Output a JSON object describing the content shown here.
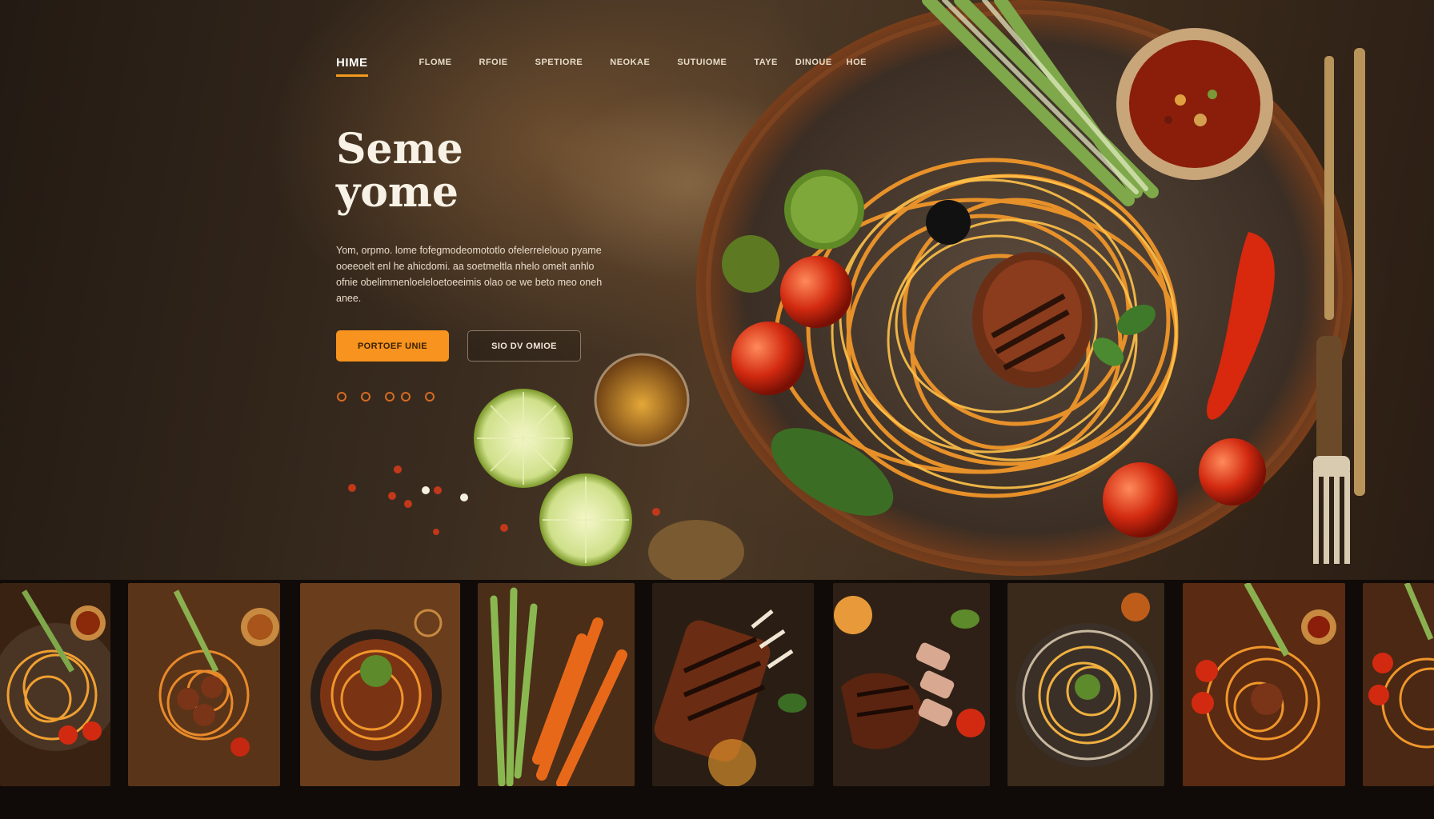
{
  "nav": {
    "items": [
      {
        "label": "HIME",
        "active": true
      },
      {
        "label": "FLOME"
      },
      {
        "label": "RFOIE"
      },
      {
        "label": "SPETIORE"
      },
      {
        "label": "NEOKAE"
      },
      {
        "label": "SUTUIOME"
      },
      {
        "label": "TAYE"
      },
      {
        "label": "DINOUE"
      },
      {
        "label": "HOE"
      }
    ]
  },
  "hero": {
    "title_line1": "Seme",
    "title_line2": "yome",
    "description": "Yom, orpmo. lome fofegmodeomototlo ofelerrelelouo pyame ooeeoelt enl he ahicdomi. aa soetmeltla nhelo omelt anhlo ofnie obelimmenloeleloetoeeimis olao oe we beto meo oneh anee.",
    "primary_button": "PORTOEF UNIE",
    "secondary_button": "SIO DV OMIOE"
  },
  "socials": [
    "social-1",
    "social-2",
    "social-3",
    "social-4",
    "social-5"
  ],
  "theme": {
    "accent": "#f7931e",
    "background": "#1a120c"
  },
  "gallery": {
    "thumbnails": [
      {
        "subject": "spaghetti-plate"
      },
      {
        "subject": "pasta-meatballs"
      },
      {
        "subject": "noodle-bowl"
      },
      {
        "subject": "green-onion-carrots"
      },
      {
        "subject": "grilled-ribs"
      },
      {
        "subject": "sliced-steak"
      },
      {
        "subject": "noodle-plate"
      },
      {
        "subject": "spaghetti-tomatoes"
      },
      {
        "subject": "spaghetti-partial"
      }
    ]
  }
}
